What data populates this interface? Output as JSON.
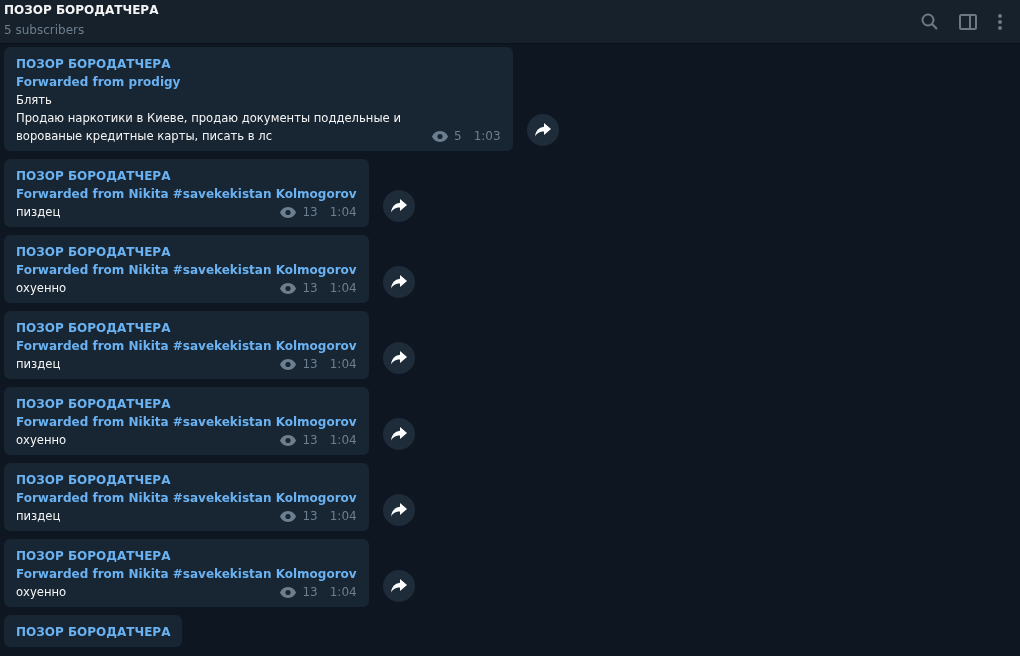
{
  "header": {
    "title": "ПОЗОР БОРОДАТЧЕРА",
    "subtitle": "5 subscribers"
  },
  "messages": [
    {
      "channel": "ПОЗОР БОРОДАТЧЕРА",
      "forwarded": "Forwarded from prodigy",
      "lines": [
        "Блять",
        "Продаю наркотики в Киеве, продаю документы поддельные и ворованые кредитные карты, писать в лс"
      ],
      "views": "5",
      "time": "1:03"
    },
    {
      "channel": "ПОЗОР БОРОДАТЧЕРА",
      "forwarded": "Forwarded from Nikita #savekekistan Kolmogorov",
      "lines": [
        "пиздец"
      ],
      "views": "13",
      "time": "1:04"
    },
    {
      "channel": "ПОЗОР БОРОДАТЧЕРА",
      "forwarded": "Forwarded from Nikita #savekekistan Kolmogorov",
      "lines": [
        "охуенно"
      ],
      "views": "13",
      "time": "1:04"
    },
    {
      "channel": "ПОЗОР БОРОДАТЧЕРА",
      "forwarded": "Forwarded from Nikita #savekekistan Kolmogorov",
      "lines": [
        "пиздец"
      ],
      "views": "13",
      "time": "1:04"
    },
    {
      "channel": "ПОЗОР БОРОДАТЧЕРА",
      "forwarded": "Forwarded from Nikita #savekekistan Kolmogorov",
      "lines": [
        "охуенно"
      ],
      "views": "13",
      "time": "1:04"
    },
    {
      "channel": "ПОЗОР БОРОДАТЧЕРА",
      "forwarded": "Forwarded from Nikita #savekekistan Kolmogorov",
      "lines": [
        "пиздец"
      ],
      "views": "13",
      "time": "1:04"
    },
    {
      "channel": "ПОЗОР БОРОДАТЧЕРА",
      "forwarded": "Forwarded from Nikita #savekekistan Kolmogorov",
      "lines": [
        "охуенно"
      ],
      "views": "13",
      "time": "1:04"
    },
    {
      "channel": "ПОЗОР БОРОДАТЧЕРА"
    }
  ]
}
